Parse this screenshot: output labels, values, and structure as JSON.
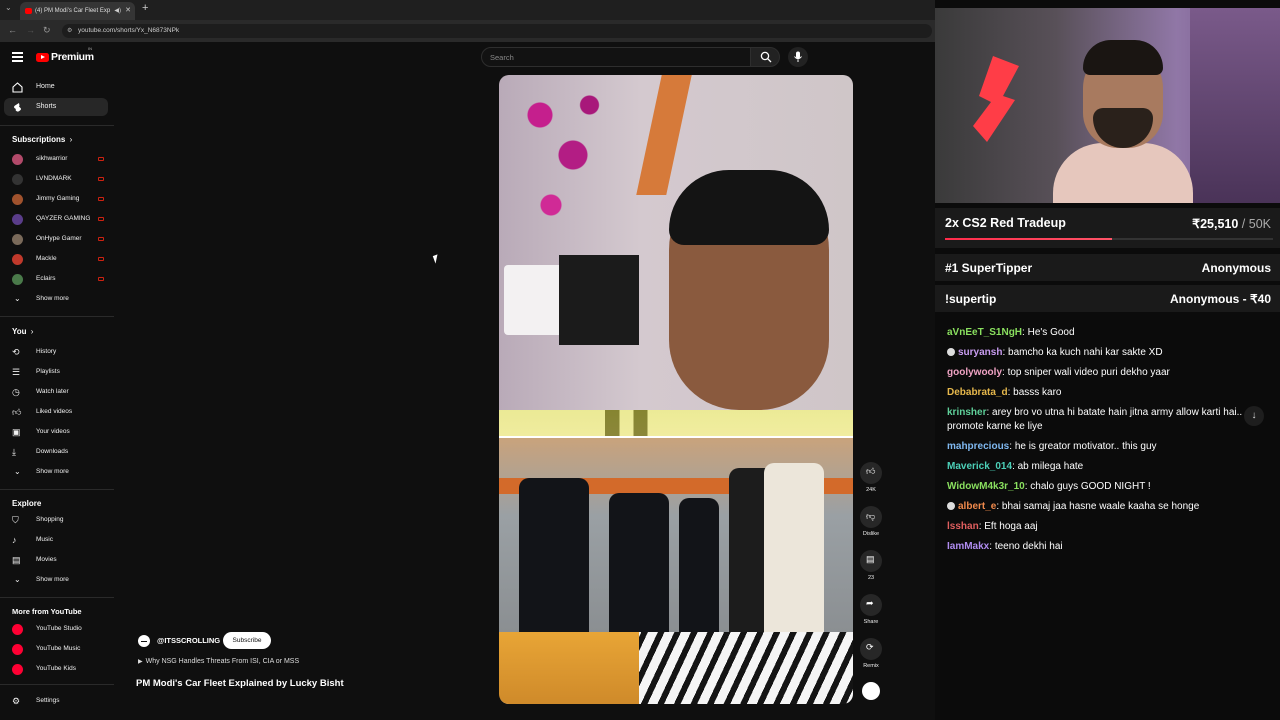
{
  "browser": {
    "tab_title": "(4) PM Modi's Car Fleet Exp",
    "url": "youtube.com/shorts/Yx_N6873NPk"
  },
  "youtube": {
    "logo_text": "Premium",
    "search_placeholder": "Search",
    "nav": {
      "home": "Home",
      "shorts": "Shorts"
    },
    "subscriptions_title": "Subscriptions",
    "subscriptions": [
      {
        "name": "sikhwarrior",
        "color": "#b24a6a"
      },
      {
        "name": "LVNDMARK",
        "color": "#222222"
      },
      {
        "name": "Jimmy Gaming",
        "color": "#a0522d"
      },
      {
        "name": "QAYZER GAMING",
        "color": "#5a3d8a"
      },
      {
        "name": "OnHype Gamer",
        "color": "#7a6a5a"
      },
      {
        "name": "Mackle",
        "color": "#c0392b"
      },
      {
        "name": "Eclairs",
        "color": "#4a7a4a"
      }
    ],
    "show_more": "Show more",
    "you_title": "You",
    "you_items": [
      "History",
      "Playlists",
      "Watch later",
      "Liked videos",
      "Your videos",
      "Downloads",
      "Show more"
    ],
    "explore_title": "Explore",
    "explore_items": [
      "Shopping",
      "Music",
      "Movies",
      "Show more"
    ],
    "more_title": "More from YouTube",
    "more_items": [
      "YouTube Studio",
      "YouTube Music",
      "YouTube Kids"
    ],
    "settings": "Settings"
  },
  "short": {
    "channel": "@ITSSCROLLING",
    "subscribe": "Subscribe",
    "related": "Why NSG Handles Threats From ISI, CIA or MSS",
    "title": "PM Modi's Car Fleet Explained by Lucky Bisht",
    "likes": "24K",
    "dislike": "Dislike",
    "comments": "23",
    "share": "Share",
    "remix": "Remix"
  },
  "stream": {
    "goal_name": "2x CS2 Red Tradeup",
    "goal_amount": "₹25,510",
    "goal_target": " / 50K",
    "goal_progress": 0.51,
    "supertipper_label": "#1 SuperTipper",
    "supertipper_value": "Anonymous",
    "supertip_cmd": "!supertip",
    "supertip_value": "Anonymous - ₹40",
    "chat": [
      {
        "user": "aVnEeT_S1NgH",
        "color": "#8ae05f",
        "text": "He's Good",
        "emote": false
      },
      {
        "user": "suryansh",
        "color": "#c89cf0",
        "text": "bamcho ka kuch nahi kar sakte XD",
        "emote": true
      },
      {
        "user": "goolywooly",
        "color": "#f0a3c4",
        "text": "top sniper wali video puri dekho yaar",
        "emote": false
      },
      {
        "user": "Debabrata_d",
        "color": "#e6b84c",
        "text": "basss karo",
        "emote": false
      },
      {
        "user": "krinsher",
        "color": "#5fd09a",
        "text": "arey bro vo utna hi batate hain jitna army allow karti hai.. promote karne ke liye",
        "emote": false
      },
      {
        "user": "mahprecious",
        "color": "#7fb8f0",
        "text": "he is greator motivator.. this guy",
        "emote": false
      },
      {
        "user": "Maverick_014",
        "color": "#4cd0b8",
        "text": "ab milega hate",
        "emote": false
      },
      {
        "user": "WidowM4k3r_10",
        "color": "#8ae05f",
        "text": "chalo guys GOOD NIGHT !",
        "emote": false
      },
      {
        "user": "albert_e",
        "color": "#f08a4c",
        "text": "bhai samaj jaa hasne waale kaaha se honge",
        "emote": true
      },
      {
        "user": "lsshan",
        "color": "#e05f5f",
        "text": "Eft hoga aaj",
        "emote": false
      },
      {
        "user": "IamMakx",
        "color": "#b08cf0",
        "text": "teeno dekhi hai",
        "emote": false
      }
    ]
  }
}
